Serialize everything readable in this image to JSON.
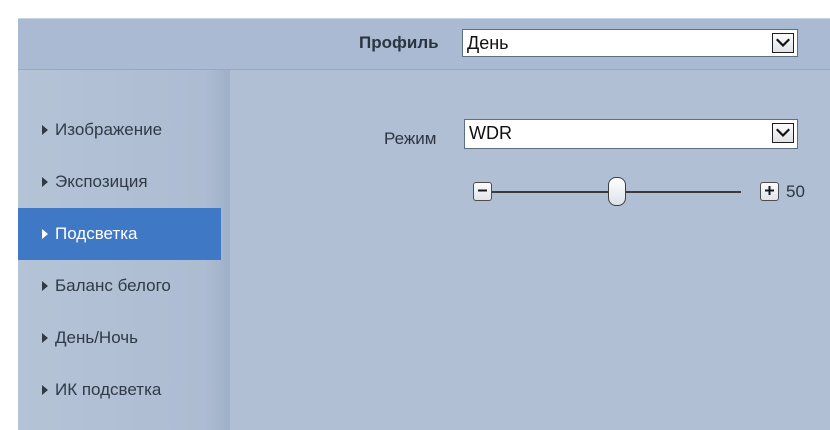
{
  "header": {
    "profile_label": "Профиль",
    "profile_value": "День"
  },
  "sidebar": {
    "items": [
      {
        "label": "Изображение",
        "active": false
      },
      {
        "label": "Экспозиция",
        "active": false
      },
      {
        "label": "Подсветка",
        "active": true
      },
      {
        "label": "Баланс белого",
        "active": false
      },
      {
        "label": "День/Ночь",
        "active": false
      },
      {
        "label": "ИК подсветка",
        "active": false
      }
    ]
  },
  "backlight": {
    "mode_label": "Режим",
    "mode_value": "WDR",
    "slider": {
      "value": 50,
      "value_text": "50",
      "min": 0,
      "max": 100
    }
  },
  "colors": {
    "accent": "#3f78c4",
    "panel": "#b1bfd4",
    "header": "#a9bad2"
  },
  "icons": {
    "nav_marker": "triangle-right-icon",
    "dropdown": "chevron-down-icon",
    "decrease": "minus-icon",
    "increase": "plus-icon"
  }
}
